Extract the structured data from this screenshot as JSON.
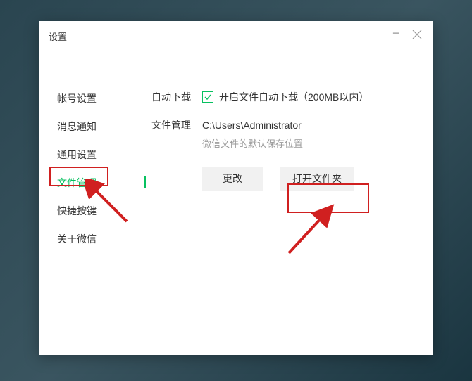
{
  "window": {
    "title": "设置"
  },
  "sidebar": {
    "items": [
      {
        "label": "帐号设置"
      },
      {
        "label": "消息通知"
      },
      {
        "label": "通用设置"
      },
      {
        "label": "文件管理",
        "active": true
      },
      {
        "label": "快捷按键"
      },
      {
        "label": "关于微信"
      }
    ]
  },
  "content": {
    "auto_download": {
      "label": "自动下载",
      "checkbox_label": "开启文件自动下载（200MB以内）",
      "checked": true
    },
    "file_management": {
      "label": "文件管理",
      "path": "C:\\Users\\Administrator",
      "hint": "微信文件的默认保存位置"
    },
    "buttons": {
      "change": "更改",
      "open_folder": "打开文件夹"
    }
  },
  "annotations": {
    "highlight_color": "#d02020",
    "arrow_color": "#d02020"
  }
}
